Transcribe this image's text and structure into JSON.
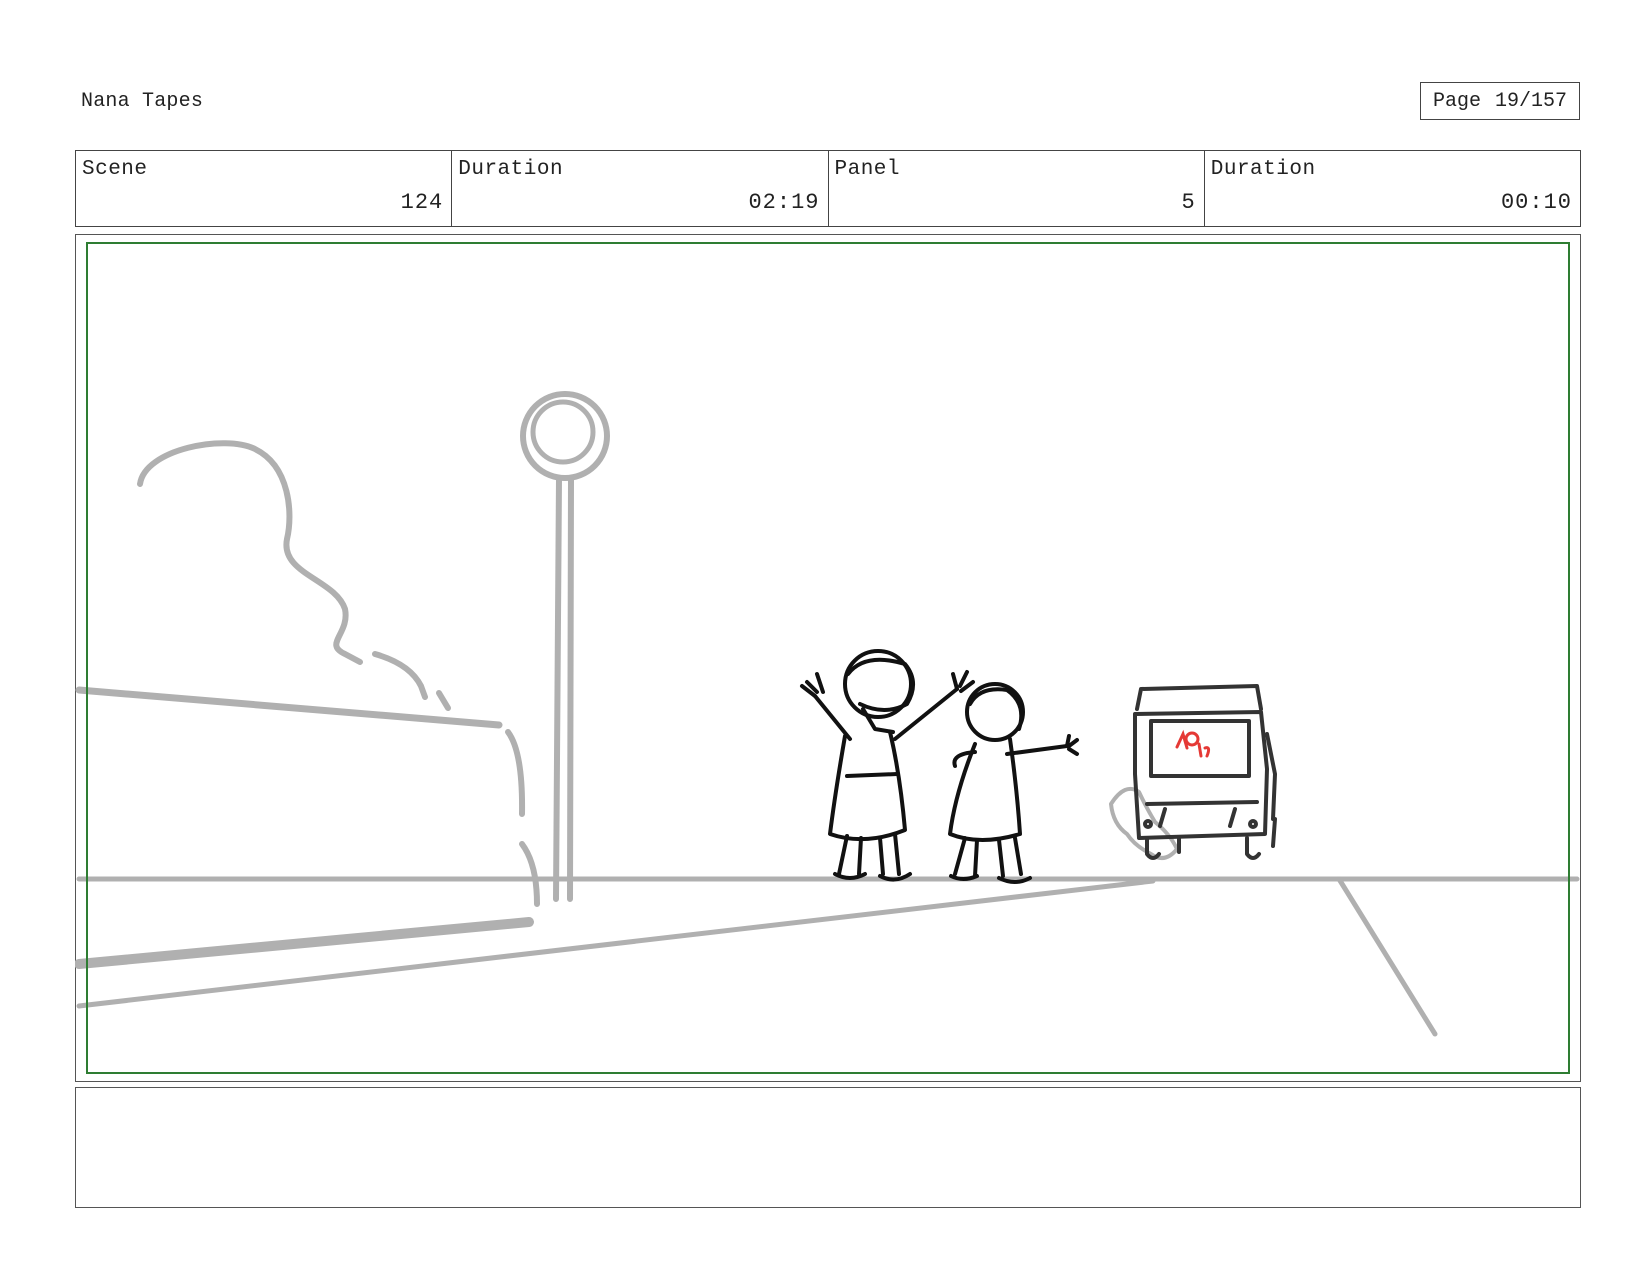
{
  "header": {
    "project_title": "Nana Tapes",
    "page_label": "Page",
    "page_number": "19/157"
  },
  "info": {
    "scene_label": "Scene",
    "scene_value": "124",
    "scene_duration_label": "Duration",
    "scene_duration_value": "02:19",
    "panel_label": "Panel",
    "panel_value": "5",
    "panel_duration_label": "Duration",
    "panel_duration_value": "00:10"
  },
  "panel": {
    "description": "",
    "accent_color": "#2e7d32",
    "sketch_color": "#111111",
    "background_sketch_color": "#b0b0b0",
    "highlight_color": "#e53935"
  },
  "notes": {
    "text": ""
  }
}
